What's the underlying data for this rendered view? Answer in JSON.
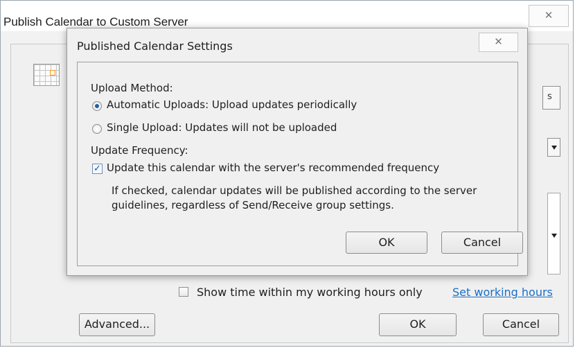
{
  "outer": {
    "title": "Publish Calendar to Custom Server",
    "close_glyph": "✕",
    "show_working_hours_label": "Show time within my working hours only",
    "set_working_hours_link": "Set working hours",
    "advanced_label": "Advanced...",
    "ok_label": "OK",
    "cancel_label": "Cancel",
    "partial_button_text": "s"
  },
  "settings_dialog": {
    "title": "Published Calendar Settings",
    "close_glyph": "✕",
    "upload_method_label": "Upload Method:",
    "upload_options": [
      {
        "label": "Automatic Uploads: Upload updates periodically",
        "selected": true
      },
      {
        "label": "Single Upload: Updates will not be uploaded",
        "selected": false
      }
    ],
    "update_frequency_label": "Update Frequency:",
    "recommended_frequency_label": "Update this calendar with the server's recommended frequency",
    "recommended_frequency_checked": true,
    "description_line1": "If checked, calendar updates will be published according to the server",
    "description_line2": "guidelines, regardless of Send/Receive group settings.",
    "ok_label": "OK",
    "cancel_label": "Cancel"
  },
  "colors": {
    "link": "#1a6fc8",
    "radio_selected": "#1f5fa8",
    "dialog_bg": "#f0f0f0"
  }
}
